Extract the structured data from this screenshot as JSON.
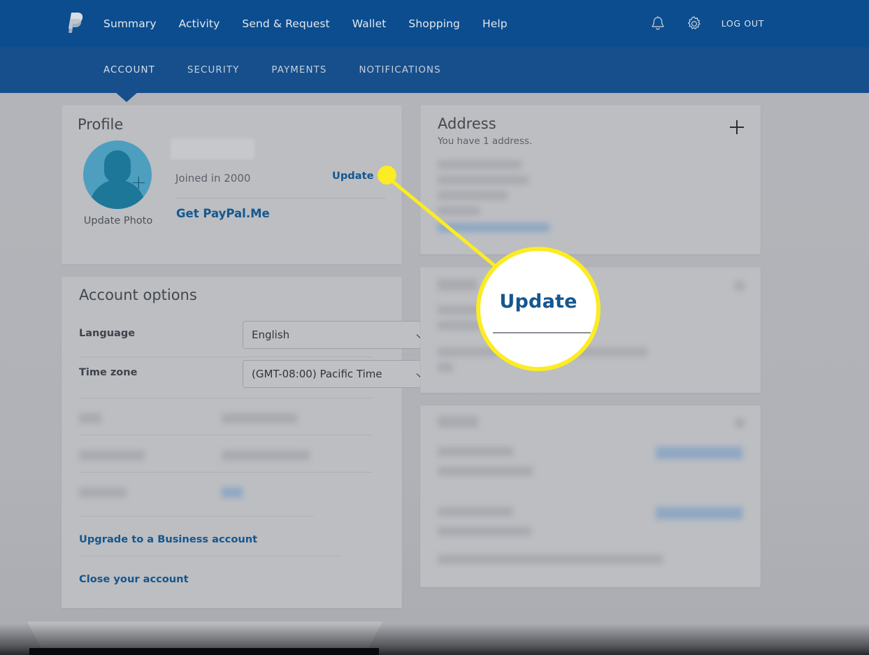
{
  "header": {
    "logo_icon": "paypal-logo-icon",
    "nav": [
      {
        "label": "Summary"
      },
      {
        "label": "Activity"
      },
      {
        "label": "Send & Request"
      },
      {
        "label": "Wallet"
      },
      {
        "label": "Shopping"
      },
      {
        "label": "Help"
      }
    ],
    "bell_icon": "notification-bell-icon",
    "gear_icon": "settings-gear-icon",
    "logout_label": "LOG OUT",
    "bg_color": "#0b4d8f"
  },
  "subnav": {
    "items": [
      {
        "label": "ACCOUNT",
        "active": true
      },
      {
        "label": "SECURITY",
        "active": false
      },
      {
        "label": "PAYMENTS",
        "active": false
      },
      {
        "label": "NOTIFICATIONS",
        "active": false
      }
    ],
    "bg_color": "#164f8c"
  },
  "profile": {
    "title": "Profile",
    "update_photo_label": "Update Photo",
    "name_redacted": "",
    "joined_label": "Joined in 2000",
    "update_label": "Update",
    "paypalme_label": "Get PayPal.Me",
    "avatar_icon": "user-avatar-icon",
    "add_photo_icon": "plus-icon"
  },
  "account_options": {
    "title": "Account options",
    "rows": [
      {
        "label": "Language",
        "value": "English"
      },
      {
        "label": "Time zone",
        "value": "(GMT-08:00) Pacific Time"
      }
    ],
    "chevron_icon": "chevron-down-icon",
    "links": [
      {
        "label": "Upgrade to a Business account"
      },
      {
        "label": "Close your account"
      }
    ]
  },
  "address": {
    "title": "Address",
    "subtitle": "You have 1 address.",
    "add_icon": "plus-icon"
  },
  "callout": {
    "magnified_label": "Update",
    "accent_color": "#fbec23",
    "link_color": "#15568f"
  },
  "theme": {
    "page_bg": "#b2b4b9",
    "card_bg": "#bcbec2",
    "link_blue": "#15568f",
    "avatar_blue": "#4e9ec0",
    "avatar_dark": "#1d7799"
  }
}
